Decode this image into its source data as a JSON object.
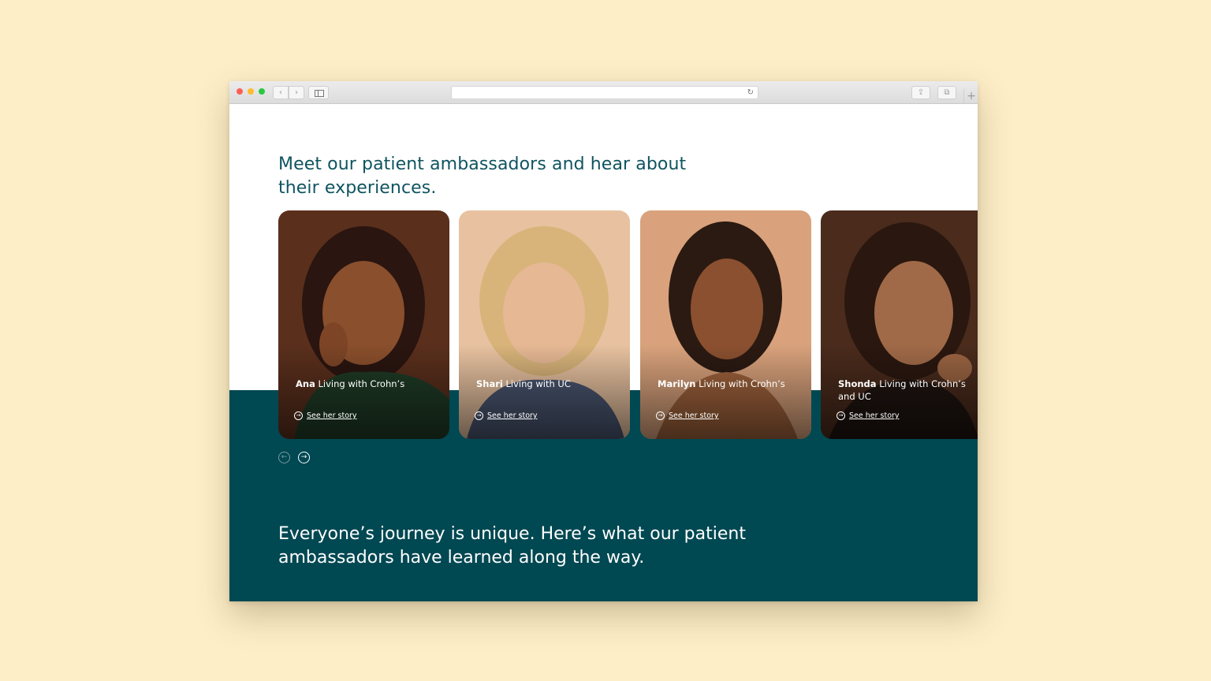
{
  "browser": {
    "url": "",
    "controls": {
      "back_icon": "‹",
      "forward_icon": "›",
      "reload_icon": "↻",
      "share_icon": "⇪",
      "tabs_icon": "⧉",
      "new_tab_icon": "+"
    }
  },
  "section": {
    "heading": "Meet our patient ambassadors and hear about their experiences.",
    "subheading": "Everyone’s journey is unique. Here’s what our patient ambassadors have learned along the way."
  },
  "ambassadors": [
    {
      "name": "Ana",
      "condition": " Living with Crohn’s",
      "link": "See her story"
    },
    {
      "name": "Shari",
      "condition": " Living with UC",
      "link": "See her story"
    },
    {
      "name": "Marilyn",
      "condition": " Living with Crohn’s",
      "link": "See her story"
    },
    {
      "name": "Shonda",
      "condition": " Living with Crohn’s and UC",
      "link": "See her story"
    }
  ],
  "carousel": {
    "prev_icon": "←",
    "next_icon": "→"
  },
  "colors": {
    "background": "#fdeec8",
    "teal": "#004852",
    "heading": "#0f5460"
  }
}
